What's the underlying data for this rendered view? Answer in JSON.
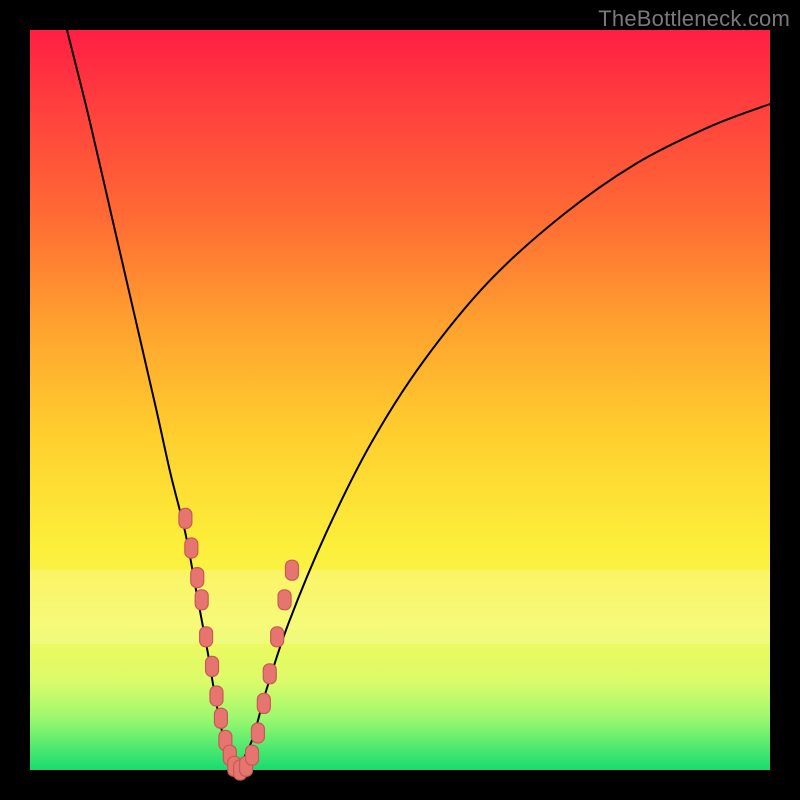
{
  "watermark": "TheBottleneck.com",
  "colors": {
    "background": "#000000",
    "curve": "#000000",
    "marker_fill": "#e6746f",
    "marker_stroke": "#c75a55"
  },
  "chart_data": {
    "type": "line",
    "title": "",
    "xlabel": "",
    "ylabel": "",
    "xlim": [
      0,
      100
    ],
    "ylim": [
      0,
      100
    ],
    "grid": false,
    "note": "Bottleneck-style V curve; x is approximate relative performance position, y is approximate bottleneck percentage (higher = worse). Values are estimated from pixel geometry since the image has no axis ticks.",
    "series": [
      {
        "name": "left-branch",
        "x": [
          5,
          8,
          11,
          14,
          17,
          19,
          21,
          22.5,
          24,
          25,
          26,
          27,
          28
        ],
        "y": [
          100,
          88,
          75,
          62,
          49,
          40,
          32,
          24,
          16,
          10,
          5,
          1,
          0
        ]
      },
      {
        "name": "right-branch",
        "x": [
          28,
          30,
          32,
          35,
          40,
          46,
          53,
          62,
          72,
          82,
          92,
          100
        ],
        "y": [
          0,
          4,
          11,
          20,
          32,
          44,
          55,
          66,
          75,
          82,
          87,
          90
        ]
      }
    ],
    "markers": {
      "name": "highlighted-points",
      "shape": "rounded-rect",
      "points": [
        {
          "x": 21.0,
          "y": 34
        },
        {
          "x": 21.8,
          "y": 30
        },
        {
          "x": 22.6,
          "y": 26
        },
        {
          "x": 23.2,
          "y": 23
        },
        {
          "x": 23.8,
          "y": 18
        },
        {
          "x": 24.6,
          "y": 14
        },
        {
          "x": 25.2,
          "y": 10
        },
        {
          "x": 25.8,
          "y": 7
        },
        {
          "x": 26.4,
          "y": 4
        },
        {
          "x": 27.0,
          "y": 2
        },
        {
          "x": 27.6,
          "y": 0.5
        },
        {
          "x": 28.4,
          "y": 0
        },
        {
          "x": 29.2,
          "y": 0.5
        },
        {
          "x": 30.0,
          "y": 2
        },
        {
          "x": 30.8,
          "y": 5
        },
        {
          "x": 31.6,
          "y": 9
        },
        {
          "x": 32.4,
          "y": 13
        },
        {
          "x": 33.4,
          "y": 18
        },
        {
          "x": 34.4,
          "y": 23
        },
        {
          "x": 35.4,
          "y": 27
        }
      ]
    }
  }
}
